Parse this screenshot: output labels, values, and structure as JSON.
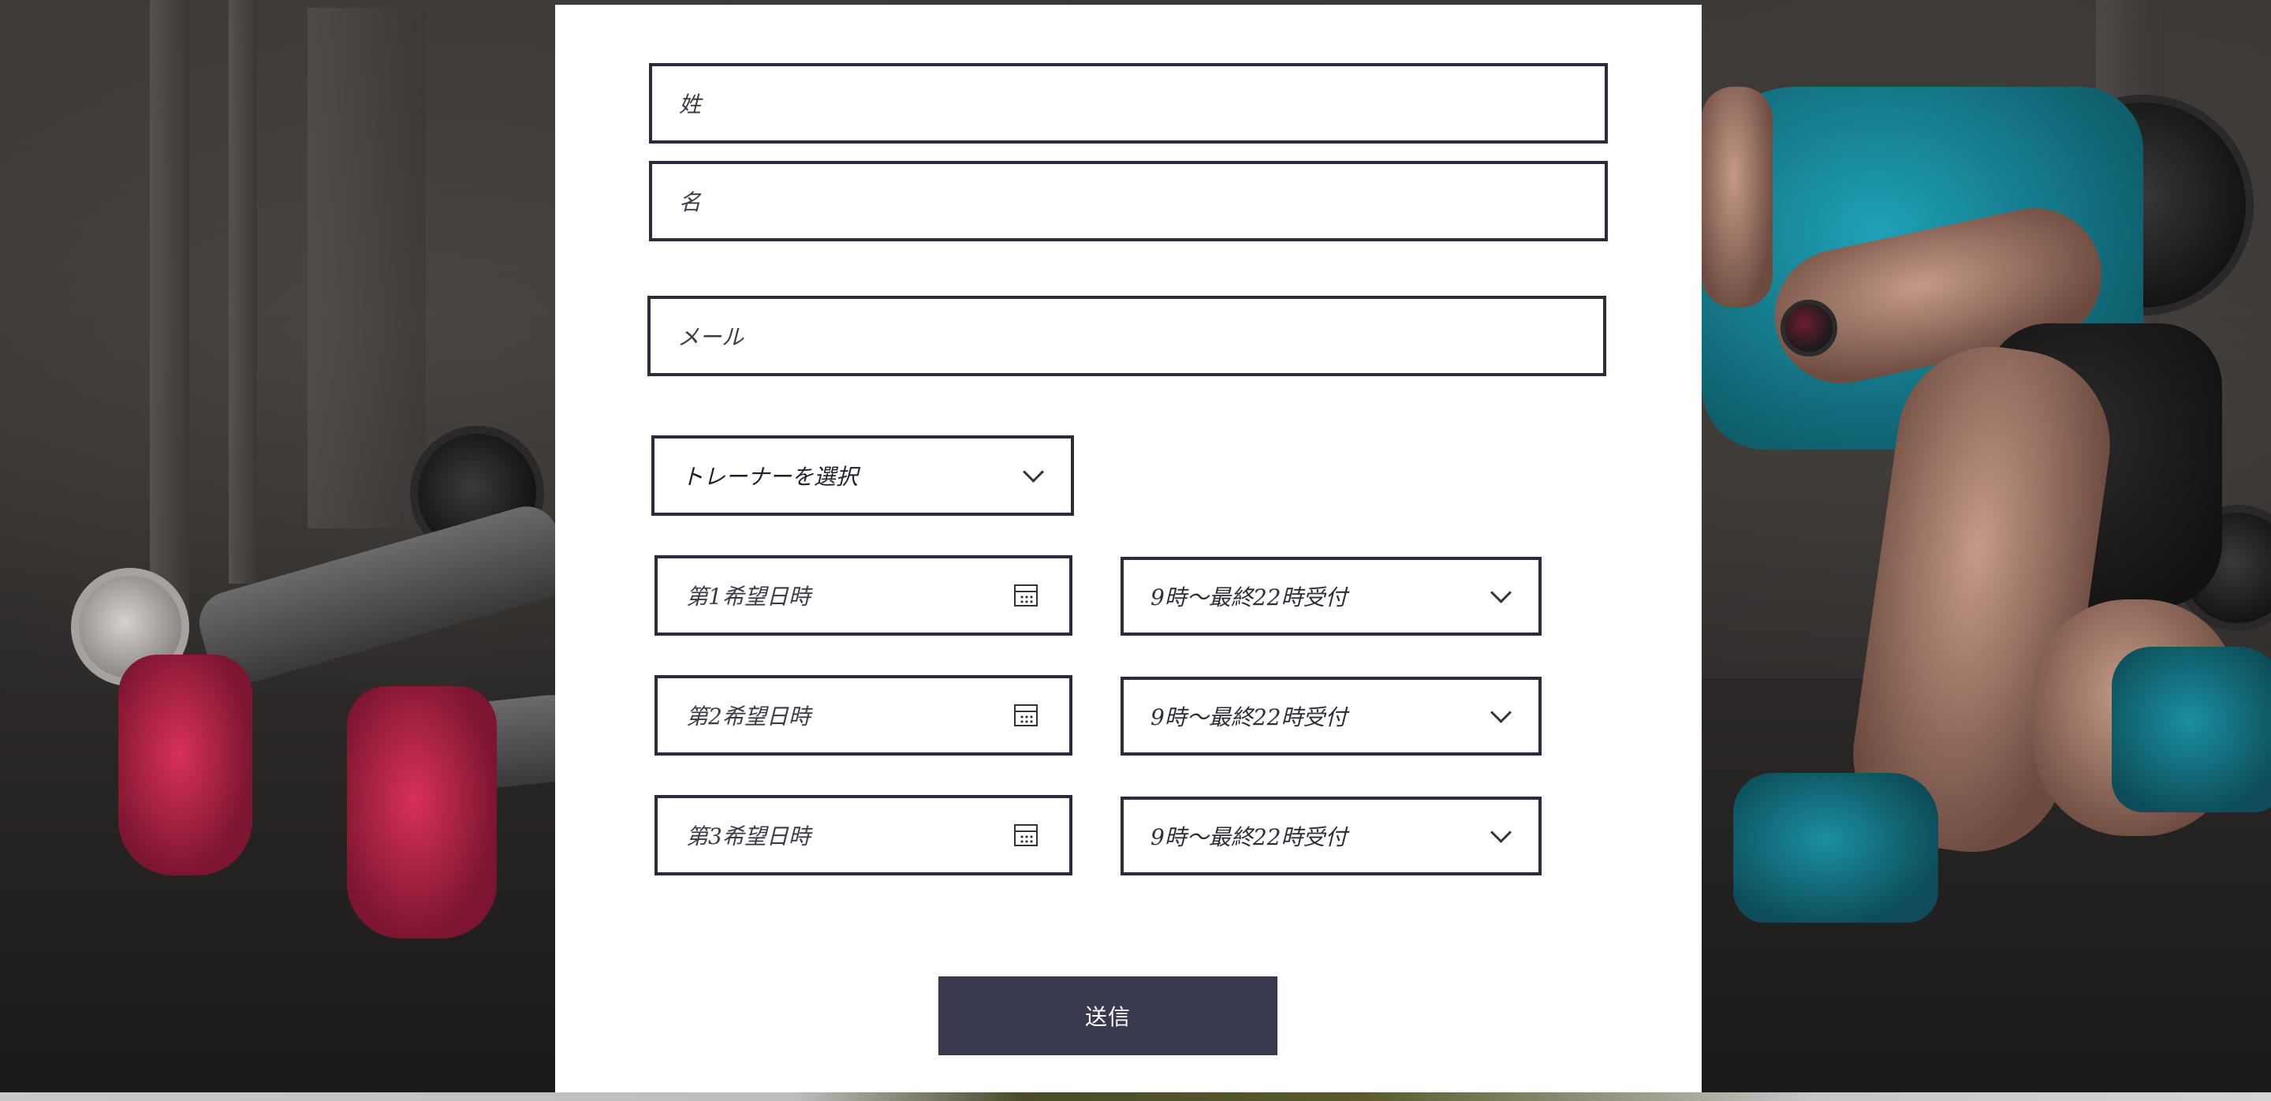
{
  "form": {
    "last_name": {
      "placeholder": "姓"
    },
    "first_name": {
      "placeholder": "名"
    },
    "email": {
      "placeholder": "メール"
    },
    "trainer_select": {
      "label": "トレーナーを選択"
    },
    "dates": [
      {
        "placeholder": "第1希望日時",
        "time_label": "9時〜最終22時受付"
      },
      {
        "placeholder": "第2希望日時",
        "time_label": "9時〜最終22時受付"
      },
      {
        "placeholder": "第3希望日時",
        "time_label": "9時〜最終22時受付"
      }
    ],
    "submit_label": "送信"
  },
  "icons": {
    "select_chevron": "chevron-down-icon",
    "date_picker": "calendar-icon"
  },
  "colors": {
    "border": "#2b2b3e",
    "button_bg": "#393a4f",
    "button_text": "#ffffff",
    "panel_bg": "#ffffff"
  }
}
